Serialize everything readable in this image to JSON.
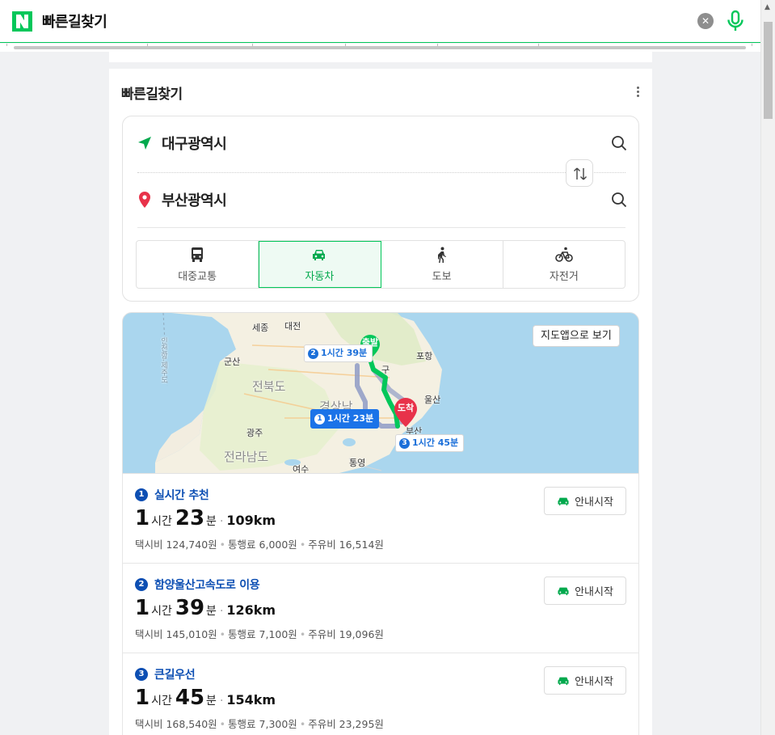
{
  "search": {
    "query": "빠른길찾기"
  },
  "card": {
    "title": "빠른길찾기"
  },
  "route_form": {
    "origin": "대구광역시",
    "destination": "부산광역시",
    "modes": [
      {
        "label": "대중교통",
        "icon": "bus-icon",
        "active": false
      },
      {
        "label": "자동차",
        "icon": "car-icon",
        "active": true
      },
      {
        "label": "도보",
        "icon": "walk-icon",
        "active": false
      },
      {
        "label": "자전거",
        "icon": "bicycle-icon",
        "active": false
      }
    ]
  },
  "map": {
    "open_app_label": "지도앱으로 보기",
    "labels": {
      "sejong": "세종",
      "daejeon": "대전",
      "gunsan": "군산",
      "jeonbuk": "전북도",
      "gwangju": "광주",
      "jeonnam": "전라남도",
      "yeosu": "여수",
      "tongyeong": "통영",
      "pohang": "포항",
      "ulsan": "울산",
      "gyeongnam": "경상남",
      "gu": "구",
      "busan": "부산",
      "daegu_partial": "대",
      "sea_route": "인천항-제주도"
    },
    "start_pin": "출발",
    "end_pin": "도착",
    "tags": [
      {
        "num": "2",
        "text": "1시간 39분"
      },
      {
        "num": "1",
        "text": "1시간 23분"
      },
      {
        "num": "3",
        "text": "1시간 45분"
      }
    ],
    "colors": {
      "selected_route": "#03c75a",
      "alt_route": "#8e9bc6",
      "end_pin": "#e8324a"
    }
  },
  "routes": [
    {
      "num": "1",
      "name": "실시간 추천",
      "hours": "1",
      "hour_unit": "시간",
      "minutes": "23",
      "minute_unit": "분",
      "distance": "109km",
      "fees": [
        "택시비 124,740원",
        "통행료 6,000원",
        "주유비 16,514원"
      ],
      "button": "안내시작"
    },
    {
      "num": "2",
      "name": "함양울산고속도로 이용",
      "hours": "1",
      "hour_unit": "시간",
      "minutes": "39",
      "minute_unit": "분",
      "distance": "126km",
      "fees": [
        "택시비 145,010원",
        "통행료 7,100원",
        "주유비 19,096원"
      ],
      "button": "안내시작"
    },
    {
      "num": "3",
      "name": "큰길우선",
      "hours": "1",
      "hour_unit": "시간",
      "minutes": "45",
      "minute_unit": "분",
      "distance": "154km",
      "fees": [
        "택시비 168,540원",
        "통행료 7,300원",
        "주유비 23,295원"
      ],
      "button": "안내시작"
    }
  ],
  "theme": {
    "brand": "#03c75a",
    "link": "#0d4fb3"
  }
}
